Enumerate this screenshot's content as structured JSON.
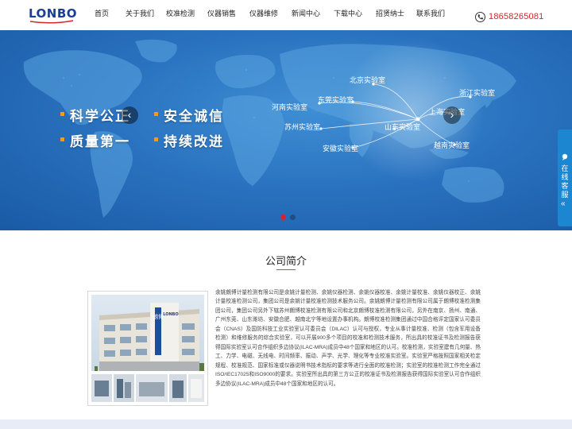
{
  "logo": {
    "text": "LONBO"
  },
  "nav": {
    "items": [
      {
        "label": "首页"
      },
      {
        "label": "关于我们"
      },
      {
        "label": "校准检测"
      },
      {
        "label": "仪器销售"
      },
      {
        "label": "仪器维修"
      },
      {
        "label": "新闻中心"
      },
      {
        "label": "下载中心"
      },
      {
        "label": "招贤纳士"
      },
      {
        "label": "联系我们"
      }
    ]
  },
  "header": {
    "phone_icon": "phone-icon",
    "phone": "18658265081"
  },
  "banner": {
    "slogans": [
      {
        "text": "科学公正"
      },
      {
        "text": "安全诚信"
      },
      {
        "text": "质量第一"
      },
      {
        "text": "持续改进"
      }
    ],
    "labs": [
      {
        "name": "北京实验室"
      },
      {
        "name": "浙江实验室"
      },
      {
        "name": "河南实验室"
      },
      {
        "name": "东莞实验室"
      },
      {
        "name": "上海实验室"
      },
      {
        "name": "苏州实验室"
      },
      {
        "name": "山东实验室"
      },
      {
        "name": "安徽实验室"
      },
      {
        "name": "越南实验室"
      }
    ],
    "prev_icon": "chevron-left-icon",
    "next_icon": "chevron-right-icon",
    "slide_count": 2,
    "active_slide": 1,
    "colors": {
      "slogan_bullet": "#f39a1a",
      "dot_active": "#d8232a",
      "dot_inactive": "#1d4f87"
    }
  },
  "service_tab": {
    "label": "在线客服",
    "arrow": "«",
    "icon": "chat-icon"
  },
  "about": {
    "title": "公司简介",
    "photo_sign": "朗博",
    "photo_logo": "LONBO",
    "paragraph": "余姚朗博计量检测有限公司是余姚计量检测、余姚仪器检测、余姚仪器校准、余姚计量校准、余姚仪器校正、余姚计量校准检测公司，集团公司是余姚计量校准检测技术服务公司。余姚朗博计量检测有限公司属于朗博校准检测集团公司，集团公司另外下辖苏州朗博校准检测有限公司和北京朗博校准检测有限公司，另外在南京、扬州、南通、广州东莞、山东潍坊、安徽合肥、越南北宁等地设置办事机构。朗博校准检测集团通过中国合格评定国家认可委员会（CNAS）及国防科技工业实验室认可委员会（DILAC）认可与授权，专业从事计量校准、检测（包含军用设备检测）和维修服务的综合实验室，可以开展900多个项目的校准和检测技术服务，所出具的校准证书及检测报告获得国际实验室认可合作组织多边协议(ILAC-MRA)成员中48个国家和地区的认可。校准检测，实验室建有几何量、热工、力学、电磁、无线电、时间频率、振动、声学、光学、理化等专业校准实验室。实验室严格按照国家相关检定规程、校准规范、国家标准或仪器说明书技术指标的要求等进行全面的校准检测；实验室的校准检测工作完全通过ISO/IEC17025和ISO9000的要求。实验室所出具的第三方公正的校准证书及检测报告获得国际实验室认可合作组织多边协议(ILAC-MRA)成员中48个国家和地区的认可。"
  },
  "colors": {
    "accent": "#1c86d1",
    "brand": "#1b3f93",
    "phone": "#d8232a"
  }
}
